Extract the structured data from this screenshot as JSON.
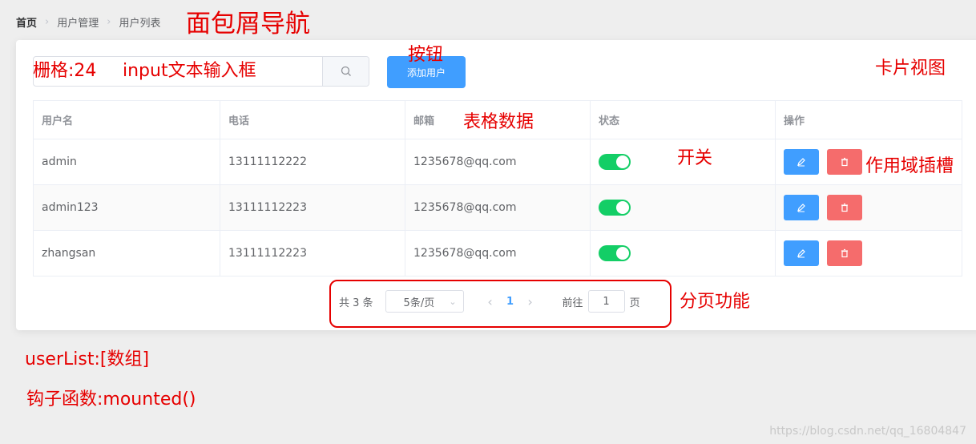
{
  "breadcrumb": [
    "首页",
    "用户管理",
    "用户列表"
  ],
  "search": {
    "value": "",
    "placeholder": ""
  },
  "add_button_label": "添加用户",
  "table": {
    "columns": [
      "用户名",
      "电话",
      "邮箱",
      "状态",
      "操作"
    ],
    "rows": [
      {
        "username": "admin",
        "phone": "13111112222",
        "email": "1235678@qq.com",
        "enabled": true
      },
      {
        "username": "admin123",
        "phone": "13111112223",
        "email": "1235678@qq.com",
        "enabled": true
      },
      {
        "username": "zhangsan",
        "phone": "13111112223",
        "email": "1235678@qq.com",
        "enabled": true
      }
    ]
  },
  "pagination": {
    "total_text": "共 3 条",
    "page_size_text": "5条/页",
    "current_page": "1",
    "goto_label": "前往",
    "goto_value": "1",
    "page_label": "页"
  },
  "annotations": {
    "breadcrumb": "面包屑导航",
    "grid": "栅格:24",
    "input": "input文本输入框",
    "button": "按钮",
    "card": "卡片视图",
    "table": "表格数据",
    "switch": "开关",
    "slot": "作用域插槽",
    "pagination": "分页功能",
    "userlist": "userList:[数组]",
    "hook": "钩子函数:mounted()"
  },
  "watermark": "https://blog.csdn.net/qq_16804847",
  "colors": {
    "primary": "#409eff",
    "danger": "#f56c6c",
    "switch_on": "#13ce66",
    "annotation": "#e60000"
  }
}
